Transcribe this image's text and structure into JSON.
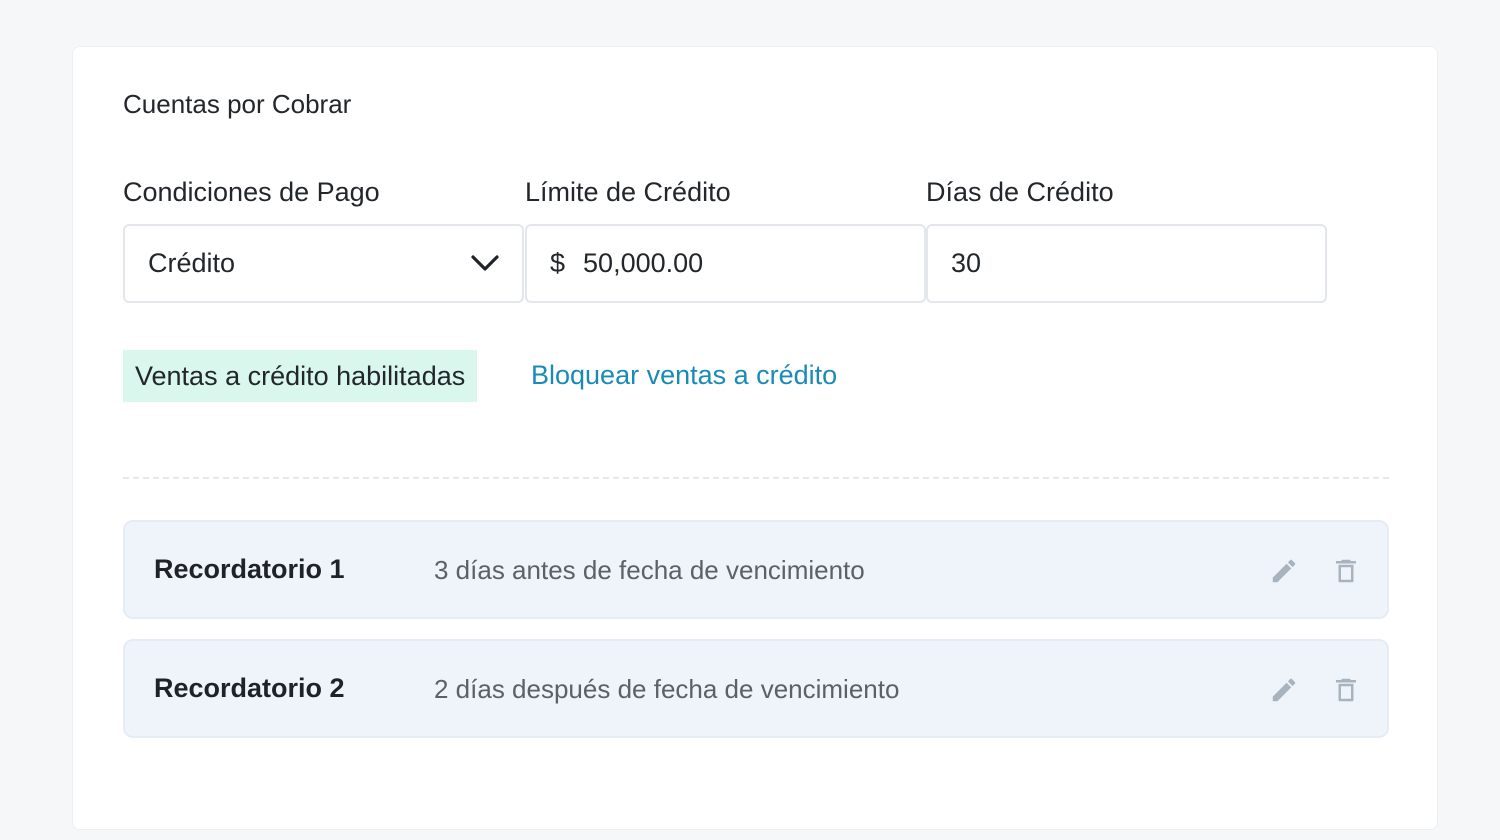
{
  "section": {
    "title": "Cuentas por Cobrar"
  },
  "fields": {
    "payment_terms": {
      "label": "Condiciones de Pago",
      "value": "Crédito"
    },
    "credit_limit": {
      "label": "Límite de Crédito",
      "currency": "$",
      "value": "50,000.00"
    },
    "credit_days": {
      "label": "Días de Crédito",
      "value": "30"
    }
  },
  "status": {
    "badge": "Ventas a crédito habilitadas",
    "action_link": "Bloquear ventas a crédito",
    "badge_color": "#d9f7ec",
    "link_color": "#1a8bb8"
  },
  "reminders": [
    {
      "title": "Recordatorio 1",
      "description": "3 días antes de fecha de vencimiento"
    },
    {
      "title": "Recordatorio 2",
      "description": "2 días después de fecha de vencimiento"
    }
  ],
  "icons": {
    "edit": "pencil-icon",
    "delete": "trash-icon",
    "dropdown": "chevron-down-icon"
  }
}
